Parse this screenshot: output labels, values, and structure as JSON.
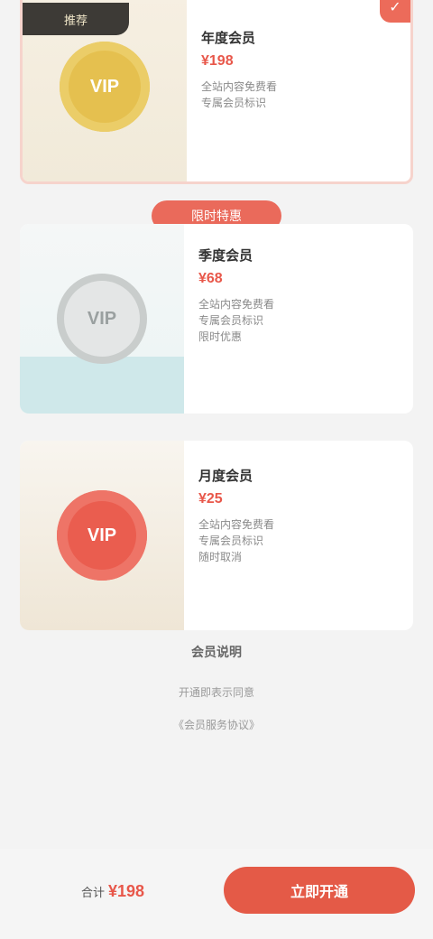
{
  "plans": [
    {
      "badge": "推荐",
      "medal_text": "VIP",
      "name": "年度会员",
      "price": "¥198",
      "desc": "全站内容免费看\n专属会员标识",
      "selected": true
    },
    {
      "tag": "",
      "medal_text": "VIP",
      "name": "季度会员",
      "price": "¥68",
      "desc": "全站内容免费看\n专属会员标识\n限时优惠"
    },
    {
      "tag": "",
      "medal_text": "VIP",
      "name": "月度会员",
      "price": "¥25",
      "desc": "全站内容免费看\n专属会员标识\n随时取消"
    }
  ],
  "promo_pill": "限时特惠",
  "footnotes": {
    "title": "会员说明",
    "line1": "开通即表示同意",
    "line2": "《会员服务协议》"
  },
  "bottom": {
    "total_label": "合计",
    "total_value": "¥198",
    "buy_label": "立即开通"
  },
  "colors": {
    "accent": "#e45a47",
    "gold": "#e5c04f",
    "teal": "#cfe8ea"
  }
}
